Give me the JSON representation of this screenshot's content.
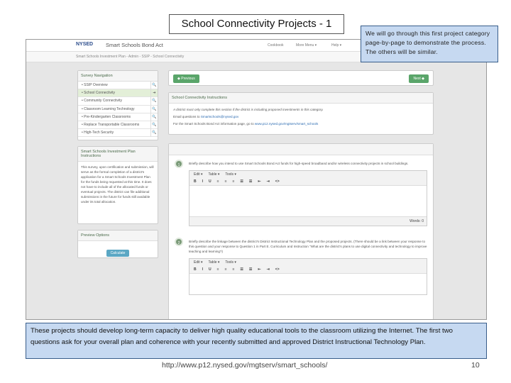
{
  "slide": {
    "title": "School Connectivity Projects - 1",
    "callout": "We will go through this first project category page-by-page to demonstrate the process. The others will be similar.",
    "note": "These projects should develop long-term capacity to deliver high quality educational tools to the classroom utilizing the Internet. The first two questions ask for your overall plan and coherence with your recently submitted and approved District Instructional Technology Plan.",
    "url": "http://www.p12.nysed.gov/mgtserv/smart_schools/",
    "page": "10"
  },
  "app": {
    "logo": "NYSED",
    "name": "Smart Schools Bond Act",
    "nav": [
      "Cookbook",
      "More Menu ▾",
      "Help ▾"
    ],
    "breadcrumb": "Smart Schools Investment Plan - Admin - SSIP - School Connectivity",
    "survey_nav": {
      "title": "Survey Navigation",
      "items": [
        {
          "label": "SSIP Overview"
        },
        {
          "label": "School Connectivity",
          "active": true
        },
        {
          "label": "Community Connectivity"
        },
        {
          "label": "Classroom Learning Technology"
        },
        {
          "label": "Pre-Kindergarten Classrooms"
        },
        {
          "label": "Replace Transportable Classrooms"
        },
        {
          "label": "High-Tech Security"
        }
      ]
    },
    "ssip_instr": {
      "title": "Smart Schools Investment Plan Instructions",
      "body": "This survey, upon certification and submission, will serve as the formal completion of a district's application for a Smart Schools Investment Plan for the funds being requested at this time. It does not have to include all of the allocated funds or eventual projects. The district can file additional submissions in the future for funds still available under its total allocation."
    },
    "preview": {
      "title": "Preview Options",
      "button": "Calculate"
    },
    "prev_label": "◆ Previous",
    "next_label": "Next ◆",
    "instructions": {
      "title": "School Connectivity Instructions",
      "line1": "A district must only complete this section if the district is including proposed investments in this category.",
      "line2_prefix": "Email questions to ",
      "email": "Smartschools@nysed.gov",
      "line3_prefix": "For the Smart Schools Bond Act information page, go to ",
      "link": "www.p12.nysed.gov/mgtserv/smart_schools"
    },
    "toolbar": {
      "menus": [
        "Edit ▾",
        "Table ▾",
        "Tools ▾"
      ],
      "buttons": [
        "B",
        "I",
        "U",
        "≡",
        "≡",
        "≡",
        "☰",
        "☰",
        "⇤",
        "⇥",
        "<>"
      ]
    },
    "questions": [
      {
        "num": "1",
        "text": "Briefly describe how you intend to use Smart Schools Bond Act funds for high-speed broadband and/or wireless connectivity projects in school buildings.",
        "words": "Words: 0"
      },
      {
        "num": "2",
        "text": "Briefly describe the linkage between the district's District Instructional Technology Plan and the proposed projects. (There should be a link between your response to this question and your response to Question 1 in Part E. Curriculum and Instruction \"What are the district's plans to use digital connectivity and technology to improve teaching and learning?)"
      }
    ]
  }
}
